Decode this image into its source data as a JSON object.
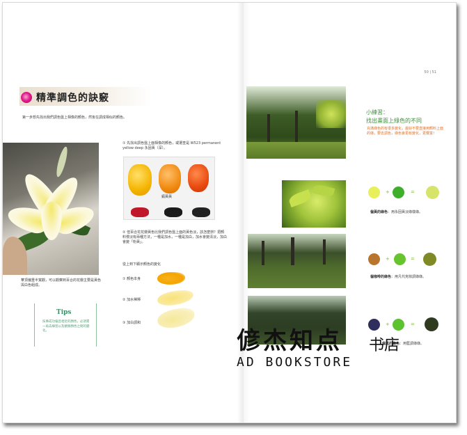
{
  "page": {
    "page_numbers": "50 | 51",
    "title": "精準調色的訣竅",
    "intro": "第一步想先找出我們調色盤上相像的顏色，然後在調成相似的顏色。",
    "lily_caption": "華頂偏重半寬觀，可以觀察到百合的花瓣主要是黃色與白色組成。",
    "tips": {
      "title": "Tips",
      "text": "技事成功偏且相近的顏色，必須累一再去練習以及觀察顏色之間的變化。"
    },
    "step1": "① 先找出調色盤上面相像的顏色，或選查是 W523 permanent yellow deep 永固黃（深）。",
    "palette_label": "鎘黃黃",
    "step2": "② 但百合花花瓣黃色比我們調色盤上面的黃色淡，該怎麼辦？把顏料慢淡有兩種方法，一種是加水，一種是加白，加水會變清淡，加白會變「粉黃」。",
    "change_title": "從上到下顯示顏色的變化",
    "swatches": [
      {
        "label": "① 顏色本身"
      },
      {
        "label": "② 加水稀釋"
      },
      {
        "label": "③ 加白調和"
      }
    ],
    "tip_box": {
      "title_line1": "小練習：",
      "title_line2": "找出畫面上綠色的不同",
      "body": "充滿綠色的有很多變化，最好不要直接用顏料上面的綠，要去調色，綠色會更有變化，更豐富！"
    },
    "mixes": [
      {
        "caption_bold": "偏黃的綠色",
        "caption": "：用永固黃淡綠樣綠。",
        "operator": "+",
        "equals": "="
      },
      {
        "caption_bold": "偏咖啡的綠色",
        "caption": "：用凡代克棕調綠綠。",
        "operator": "+",
        "equals": "="
      },
      {
        "caption_bold": "偏黑的綠色",
        "caption": "：用藍調綠綠。",
        "operator": "+",
        "equals": "="
      }
    ],
    "watermark": {
      "chinese": "偐杰知点",
      "chinese_script": "书店",
      "english": "AD BOOKSTORE"
    }
  },
  "colors": {
    "title_accent": "#e01e8c",
    "green_text": "#3e8f3e",
    "orange_text": "#e0722a",
    "tips_green": "#3f8f68"
  }
}
